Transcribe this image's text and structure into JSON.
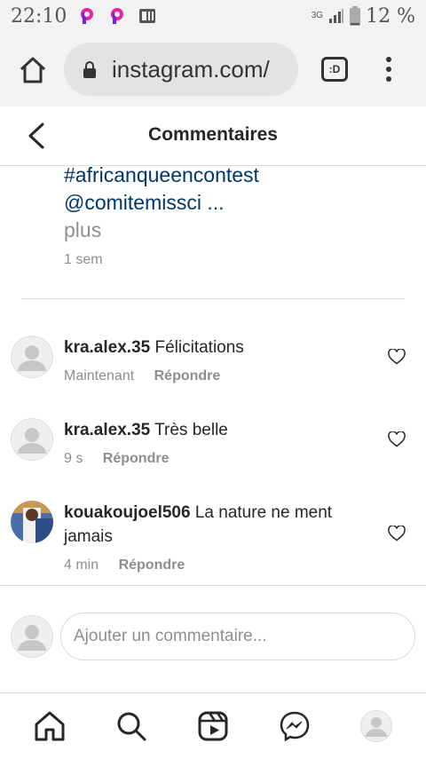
{
  "status_bar": {
    "time": "22:10",
    "network": "3G",
    "battery": "12 %"
  },
  "browser": {
    "url": "instagram.com/",
    "tab_label": ":D"
  },
  "header": {
    "title": "Commentaires"
  },
  "caption": {
    "hashtag": "#africanqueencontest",
    "mention": "@comitemissci ...",
    "more": "plus",
    "time": "1 sem"
  },
  "comments": [
    {
      "username": "kra.alex.35",
      "text": "Félicitations",
      "time": "Maintenant",
      "reply": "Répondre"
    },
    {
      "username": "kra.alex.35",
      "text": "Très belle",
      "time": "9 s",
      "reply": "Répondre"
    },
    {
      "username": "kouakoujoel506",
      "text": "La nature ne ment jamais",
      "time": "4 min",
      "reply": "Répondre"
    }
  ],
  "compose": {
    "placeholder": "Ajouter un commentaire..."
  },
  "colors": {
    "link": "#00376b",
    "muted": "#8e8e8e",
    "text": "#262626"
  },
  "icons": [
    "home-icon",
    "search-icon",
    "reels-icon",
    "messenger-icon",
    "profile-avatar"
  ]
}
